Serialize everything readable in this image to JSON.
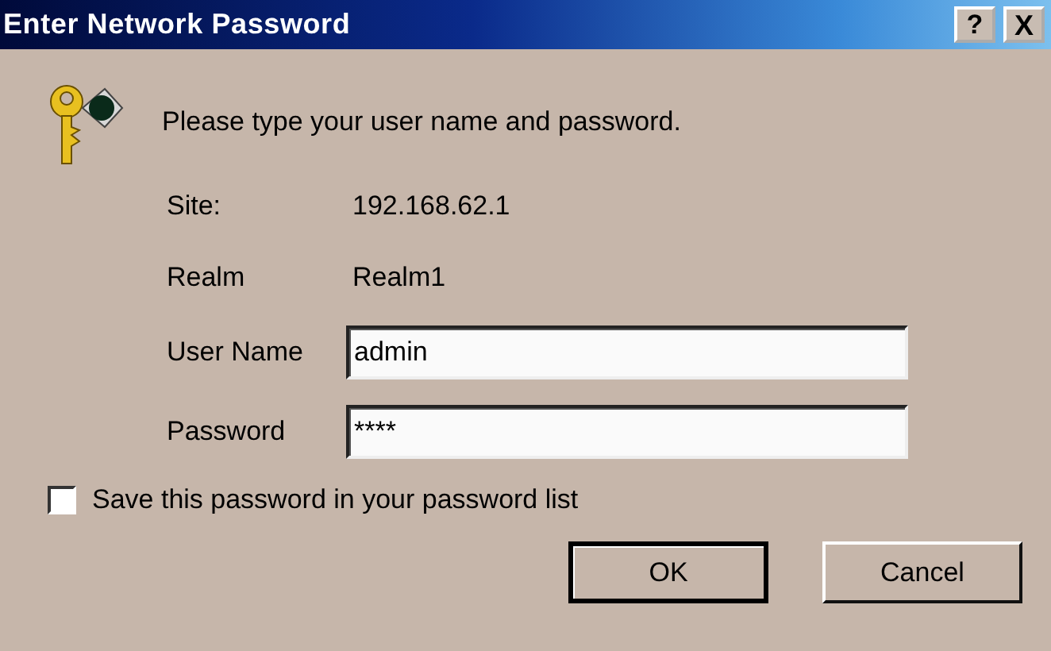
{
  "window": {
    "title": "Enter Network Password",
    "title_buttons": [
      {
        "kind": "help",
        "label": "?"
      },
      {
        "kind": "close",
        "label": "X"
      }
    ]
  },
  "message": "Please type your user name and password.",
  "info": [
    {
      "label": "Site:",
      "value": "192.168.62.1"
    },
    {
      "label": "Realm",
      "value": "Realm1"
    }
  ],
  "fields": [
    {
      "label": "User Name",
      "value": "admin"
    },
    {
      "label": "Password",
      "value": "****"
    }
  ],
  "save_password": {
    "label": "Save this password in your password list",
    "checked": false
  },
  "buttons": [
    {
      "label": "OK",
      "default": true
    },
    {
      "label": "Cancel",
      "default": false
    }
  ]
}
